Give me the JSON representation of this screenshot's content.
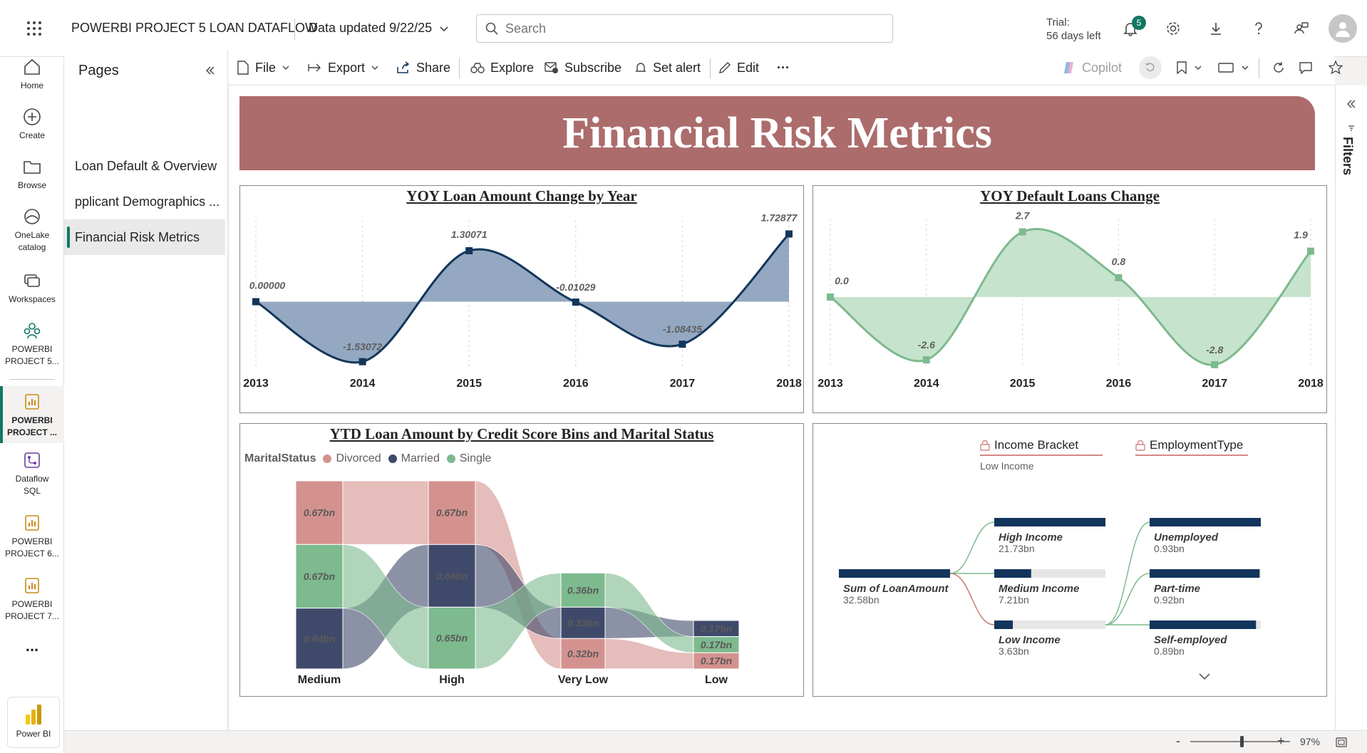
{
  "header": {
    "project_title": "POWERBI PROJECT 5 LOAN DATAFLOW",
    "data_updated": "Data updated 9/22/25",
    "search_placeholder": "Search",
    "trial_label": "Trial:",
    "trial_days": "56 days left",
    "notification_count": "5"
  },
  "rail": {
    "items": [
      {
        "label": "Home",
        "icon": "home-icon"
      },
      {
        "label": "Create",
        "icon": "plus-circle-icon"
      },
      {
        "label": "Browse",
        "icon": "folder-icon"
      },
      {
        "label_line1": "OneLake",
        "label_line2": "catalog",
        "icon": "onelake-icon"
      },
      {
        "label": "Workspaces",
        "icon": "workspaces-icon"
      },
      {
        "label_line1": "POWERBI",
        "label_line2": "PROJECT 5...",
        "icon": "workspace-people-icon"
      },
      {
        "label_line1": "POWERBI",
        "label_line2": "PROJECT ...",
        "icon": "report-icon"
      },
      {
        "label_line1": "Dataflow",
        "label_line2": "SQL",
        "icon": "dataflow-icon"
      },
      {
        "label_line1": "POWERBI",
        "label_line2": "PROJECT 6...",
        "icon": "report-icon"
      },
      {
        "label_line1": "POWERBI",
        "label_line2": "PROJECT 7...",
        "icon": "report-icon"
      }
    ],
    "more": "...",
    "app_label": "Power BI"
  },
  "pages": {
    "title": "Pages",
    "items": [
      "Loan Default & Overview",
      "pplicant Demographics ...",
      "Financial Risk Metrics"
    ],
    "active_index": 2
  },
  "toolbar": {
    "file": "File",
    "export": "Export",
    "share": "Share",
    "explore": "Explore",
    "subscribe": "Subscribe",
    "set_alert": "Set alert",
    "edit": "Edit",
    "more": "···",
    "copilot": "Copilot"
  },
  "report": {
    "banner_title": "Financial Risk Metrics",
    "banner_color": "#ac6c6c",
    "filters_label": "Filters"
  },
  "chart_data": [
    {
      "type": "area",
      "title": "YOY Loan Amount Change by Year",
      "x": [
        "2013",
        "2014",
        "2015",
        "2016",
        "2017",
        "2018"
      ],
      "values": [
        0.0,
        -1.53072,
        1.30071,
        -0.01029,
        -1.08435,
        1.72877
      ],
      "labels": [
        "0.00000",
        "-1.53072",
        "1.30071",
        "-0.01029",
        "-1.08435",
        "1.72877"
      ],
      "ylim": [
        -1.7,
        1.9
      ],
      "color": "#12355b",
      "fill": "#94a8c2",
      "grid": false
    },
    {
      "type": "area",
      "title": "YOY Default Loans Change",
      "x": [
        "2013",
        "2014",
        "2015",
        "2016",
        "2017",
        "2018"
      ],
      "values": [
        0.0,
        -2.6,
        2.7,
        0.8,
        -2.8,
        1.9
      ],
      "labels": [
        "0.0",
        "-2.6",
        "2.7",
        "0.8",
        "-2.8",
        "1.9"
      ],
      "ylim": [
        -2.95,
        2.95
      ],
      "color": "#7dba8e",
      "fill": "#c6e3cd",
      "grid": false
    },
    {
      "type": "bar",
      "title": "YTD Loan Amount by Credit Score Bins and Marital Status",
      "legend_title": "MaritalStatus",
      "series": [
        {
          "name": "Divorced",
          "color": "#d4928f"
        },
        {
          "name": "Married",
          "color": "#3f4a6b"
        },
        {
          "name": "Single",
          "color": "#7dba8e"
        }
      ],
      "categories": [
        "Medium",
        "High",
        "Very Low",
        "Low"
      ],
      "stacks": [
        [
          {
            "series": "Divorced",
            "value": 0.67,
            "label": "0.67bn"
          },
          {
            "series": "Single",
            "value": 0.67,
            "label": "0.67bn"
          },
          {
            "series": "Married",
            "value": 0.64,
            "label": "0.64bn"
          }
        ],
        [
          {
            "series": "Divorced",
            "value": 0.67,
            "label": "0.67bn"
          },
          {
            "series": "Married",
            "value": 0.66,
            "label": "0.66bn"
          },
          {
            "series": "Single",
            "value": 0.65,
            "label": "0.65bn"
          }
        ],
        [
          {
            "series": "Single",
            "value": 0.36,
            "label": "0.36bn"
          },
          {
            "series": "Married",
            "value": 0.33,
            "label": "0.33bn"
          },
          {
            "series": "Divorced",
            "value": 0.32,
            "label": "0.32bn"
          }
        ],
        [
          {
            "series": "Married",
            "value": 0.17,
            "label": "0.17bn"
          },
          {
            "series": "Single",
            "value": 0.17,
            "label": "0.17bn"
          },
          {
            "series": "Divorced",
            "value": 0.17,
            "label": "0.17bn"
          }
        ]
      ],
      "ylim": [
        0,
        1.98
      ]
    },
    {
      "type": "decomposition-tree",
      "headers": [
        {
          "label": "Income Bracket",
          "sublabel": "Low Income"
        },
        {
          "label": "EmploymentType",
          "sublabel": ""
        }
      ],
      "root": {
        "label": "Sum of LoanAmount",
        "value_label": "32.58bn",
        "value": 32.58
      },
      "level1": [
        {
          "label": "High Income",
          "value_label": "21.73bn",
          "value": 21.73
        },
        {
          "label": "Medium Income",
          "value_label": "7.21bn",
          "value": 7.21
        },
        {
          "label": "Low Income",
          "value_label": "3.63bn",
          "value": 3.63,
          "selected": true
        }
      ],
      "level2": [
        {
          "label": "Unemployed",
          "value_label": "0.93bn",
          "value": 0.93
        },
        {
          "label": "Part-time",
          "value_label": "0.92bn",
          "value": 0.92
        },
        {
          "label": "Self-employed",
          "value_label": "0.89bn",
          "value": 0.89
        }
      ],
      "bar_color": "#12355b",
      "track_color": "#e6e6e6"
    }
  ],
  "status": {
    "zoom": "97%"
  }
}
